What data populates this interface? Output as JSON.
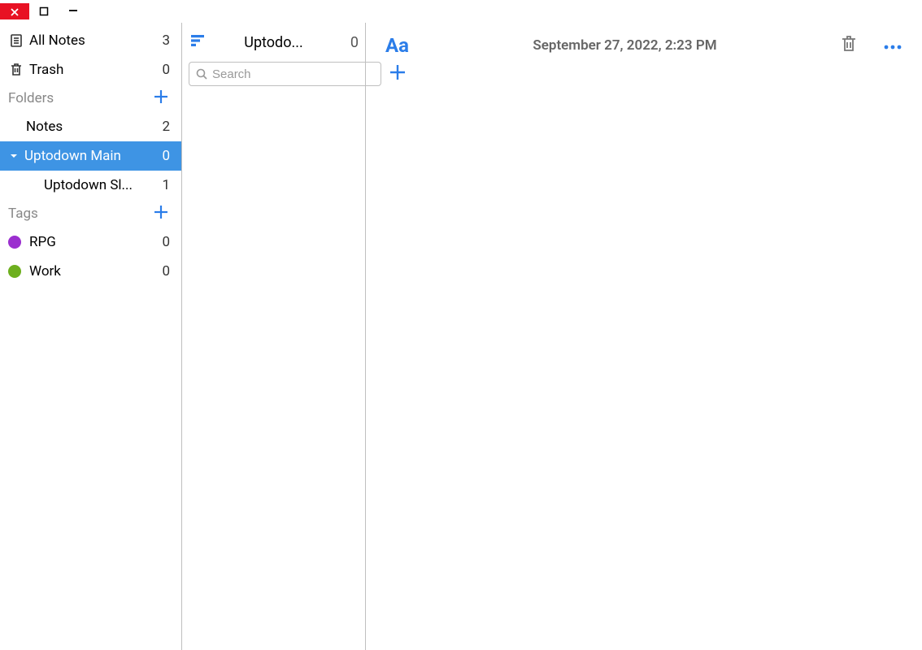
{
  "sidebar": {
    "all_notes": {
      "label": "All Notes",
      "count": "3"
    },
    "trash": {
      "label": "Trash",
      "count": "0"
    },
    "folders_header": "Folders",
    "folders": [
      {
        "label": "Notes",
        "count": "2"
      },
      {
        "label": "Uptodown Main",
        "count": "0"
      },
      {
        "label": "Uptodown Sl...",
        "count": "1"
      }
    ],
    "tags_header": "Tags",
    "tags": [
      {
        "label": "RPG",
        "count": "0",
        "color": "#9b2fcf"
      },
      {
        "label": "Work",
        "count": "0",
        "color": "#6daf1e"
      }
    ]
  },
  "middle": {
    "title": "Uptodo...",
    "count": "0",
    "search_placeholder": "Search"
  },
  "detail": {
    "format_label": "Aa",
    "date": "September 27, 2022, 2:23 PM"
  }
}
